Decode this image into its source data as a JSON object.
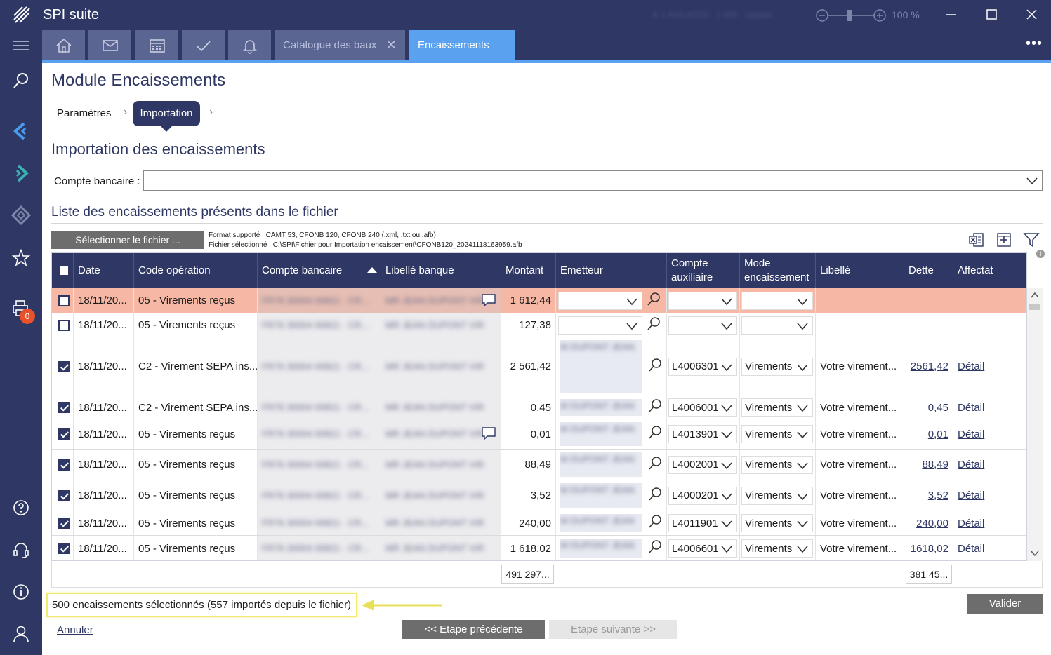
{
  "app": {
    "title": "SPI suite",
    "status_blurred": "E 1 AGILATOS · 1 005 · Update",
    "zoom": "100 %"
  },
  "tabs": {
    "catalogue": "Catalogue des baux",
    "encaissements": "Encaissements",
    "more": "•••"
  },
  "sidebar": {
    "badge": "0"
  },
  "page": {
    "module_title": "Module Encaissements",
    "breadcrumb": {
      "step1": "Paramètres",
      "step2": "Importation",
      "sep": "›"
    },
    "section_title": "Importation des encaissements",
    "compte_label": "Compte bancaire :",
    "compte_value": "",
    "list_title": "Liste des encaissements présents dans le fichier",
    "file_button": "Sélectionner le fichier ...",
    "format_line": "Format supporté : CAMT 53, CFONB 120, CFONB 240 (.xml, .txt ou .afb)",
    "file_line": "Fichier sélectionné : C:\\SPI\\Fichier pour Importation encaissement\\CFONB120_20241118163959.afb"
  },
  "grid": {
    "headers": {
      "date": "Date",
      "code": "Code opération",
      "compte": "Compte bancaire",
      "libelle_banque": "Libellé banque",
      "montant": "Montant",
      "emetteur": "Emetteur",
      "compte_aux": "Compte auxiliaire",
      "mode": "Mode encaissement",
      "libelle": "Libellé",
      "dette": "Dette",
      "affectat": "Affectat"
    },
    "rows": [
      {
        "checked": false,
        "date": "18/11/20...",
        "code": "05 - Virements reçus",
        "montant": "1 612,44",
        "compte_aux": "",
        "mode": "",
        "libelle": "",
        "dette": "",
        "detail": ""
      },
      {
        "checked": false,
        "date": "18/11/20...",
        "code": "05 - Virements reçus",
        "montant": "127,38",
        "compte_aux": "",
        "mode": "",
        "libelle": "",
        "dette": "",
        "detail": ""
      },
      {
        "checked": true,
        "date": "18/11/20...",
        "code": "C2 - Virement SEPA ins...",
        "montant": "2 561,42",
        "compte_aux": "L4006301",
        "mode": "Virements",
        "libelle": "Votre virement...",
        "dette": "2561,42",
        "detail": "Détail"
      },
      {
        "checked": true,
        "date": "18/11/20...",
        "code": "C2 - Virement SEPA ins...",
        "montant": "0,45",
        "compte_aux": "L4006001",
        "mode": "Virements",
        "libelle": "Votre virement...",
        "dette": "0,45",
        "detail": "Détail"
      },
      {
        "checked": true,
        "date": "18/11/20...",
        "code": "05 - Virements reçus",
        "montant": "0,01",
        "compte_aux": "L4013901",
        "mode": "Virements",
        "libelle": "Votre virement...",
        "dette": "0,01",
        "detail": "Détail"
      },
      {
        "checked": true,
        "date": "18/11/20...",
        "code": "05 - Virements reçus",
        "montant": "88,49",
        "compte_aux": "L4002001",
        "mode": "Virements",
        "libelle": "Votre virement...",
        "dette": "88,49",
        "detail": "Détail"
      },
      {
        "checked": true,
        "date": "18/11/20...",
        "code": "05 - Virements reçus",
        "montant": "3,52",
        "compte_aux": "L4000201",
        "mode": "Virements",
        "libelle": "Votre virement...",
        "dette": "3,52",
        "detail": "Détail"
      },
      {
        "checked": true,
        "date": "18/11/20...",
        "code": "05 - Virements reçus",
        "montant": "240,00",
        "compte_aux": "L4011901",
        "mode": "Virements",
        "libelle": "Votre virement...",
        "dette": "240,00",
        "detail": "Détail"
      },
      {
        "checked": true,
        "date": "18/11/20...",
        "code": "05 - Virements reçus",
        "montant": "1 618,02",
        "compte_aux": "L4006601",
        "mode": "Virements",
        "libelle": "Votre virement...",
        "dette": "1618,02",
        "detail": "Détail"
      }
    ],
    "blurred": {
      "compte": "FR76 30004 00821 · CR...",
      "libelle_banque": "MR JEAN DUPONT VIR",
      "emetteur": "M DUPONT JEAN"
    },
    "totals": {
      "montant": "491 297...",
      "dette": "381 45..."
    }
  },
  "footer": {
    "status": "500 encaissements sélectionnés (557 importés depuis le fichier)",
    "valider": "Valider",
    "annuler": "Annuler",
    "prev": "<< Etape précédente",
    "next": "Etape suivante >>"
  },
  "colors": {
    "navy": "#2f3864",
    "accent": "#5aa2f0",
    "highlight_row": "#f6b8a4",
    "badge": "#e8512a",
    "annotation": "#f0ea70"
  }
}
